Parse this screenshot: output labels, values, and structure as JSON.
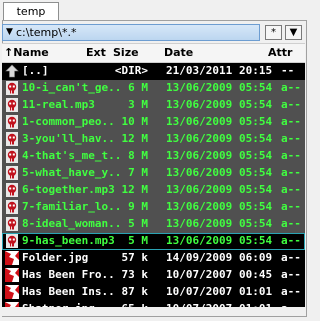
{
  "tab": {
    "label": "temp"
  },
  "path": {
    "value": "c:\\temp\\*.*",
    "star_label": "*",
    "down_label": "▼"
  },
  "header": {
    "name": "↑Name",
    "ext": "Ext",
    "size": "Size",
    "date": "Date",
    "attr": "Attr"
  },
  "colors": {
    "music": "#40ff40",
    "selected_bg": "#505050",
    "normal": "#ffffff",
    "path_bg": "#c8ddf2"
  },
  "files": [
    {
      "icon": "parent-folder-icon",
      "name": "[..]",
      "size": "<DIR>",
      "date": "21/03/2011",
      "time": "20:15",
      "attr": "--",
      "color": "#ffffff",
      "selected": false
    },
    {
      "icon": "mp3-icon",
      "name": "10-i_can't_ge..",
      "size": "6 M",
      "date": "13/06/2009",
      "time": "05:54",
      "attr": "a--",
      "color": "#40ff40",
      "selected": true
    },
    {
      "icon": "mp3-icon",
      "name": "11-real.mp3",
      "size": "3 M",
      "date": "13/06/2009",
      "time": "05:54",
      "attr": "a--",
      "color": "#40ff40",
      "selected": true
    },
    {
      "icon": "mp3-icon",
      "name": "1-common_peo..",
      "size": "10 M",
      "date": "13/06/2009",
      "time": "05:54",
      "attr": "a--",
      "color": "#40ff40",
      "selected": true
    },
    {
      "icon": "mp3-icon",
      "name": "3-you'll_hav..",
      "size": "12 M",
      "date": "13/06/2009",
      "time": "05:54",
      "attr": "a--",
      "color": "#40ff40",
      "selected": true
    },
    {
      "icon": "mp3-icon",
      "name": "4-that's_me_t..",
      "size": "8 M",
      "date": "13/06/2009",
      "time": "05:54",
      "attr": "a--",
      "color": "#40ff40",
      "selected": true
    },
    {
      "icon": "mp3-icon",
      "name": "5-what_have_y..",
      "size": "7 M",
      "date": "13/06/2009",
      "time": "05:54",
      "attr": "a--",
      "color": "#40ff40",
      "selected": true
    },
    {
      "icon": "mp3-icon",
      "name": "6-together.mp3",
      "size": "12 M",
      "date": "13/06/2009",
      "time": "05:54",
      "attr": "a--",
      "color": "#40ff40",
      "selected": true
    },
    {
      "icon": "mp3-icon",
      "name": "7-familiar_lo..",
      "size": "9 M",
      "date": "13/06/2009",
      "time": "05:54",
      "attr": "a--",
      "color": "#40ff40",
      "selected": true
    },
    {
      "icon": "mp3-icon",
      "name": "8-ideal_woman..",
      "size": "5 M",
      "date": "13/06/2009",
      "time": "05:54",
      "attr": "a--",
      "color": "#40ff40",
      "selected": true
    },
    {
      "icon": "mp3-icon",
      "name": "9-has_been.mp3",
      "size": "5 M",
      "date": "13/06/2009",
      "time": "05:54",
      "attr": "a--",
      "color": "#40ff40",
      "selected": false,
      "cursor": true
    },
    {
      "icon": "image-icon",
      "name": "Folder.jpg",
      "size": "57 k",
      "date": "14/09/2009",
      "time": "06:09",
      "attr": "a--",
      "color": "#ffffff",
      "selected": false
    },
    {
      "icon": "image-icon",
      "name": "Has Been Fro..",
      "size": "73 k",
      "date": "10/07/2007",
      "time": "00:45",
      "attr": "a--",
      "color": "#ffffff",
      "selected": false
    },
    {
      "icon": "image-icon",
      "name": "Has Been Ins..",
      "size": "87 k",
      "date": "10/07/2007",
      "time": "01:01",
      "attr": "a--",
      "color": "#ffffff",
      "selected": false
    },
    {
      "icon": "image-icon",
      "name": "Shatner.jpg",
      "size": "65 k",
      "date": "10/07/2007",
      "time": "01:01",
      "attr": "a--",
      "color": "#ffffff",
      "selected": false
    }
  ]
}
